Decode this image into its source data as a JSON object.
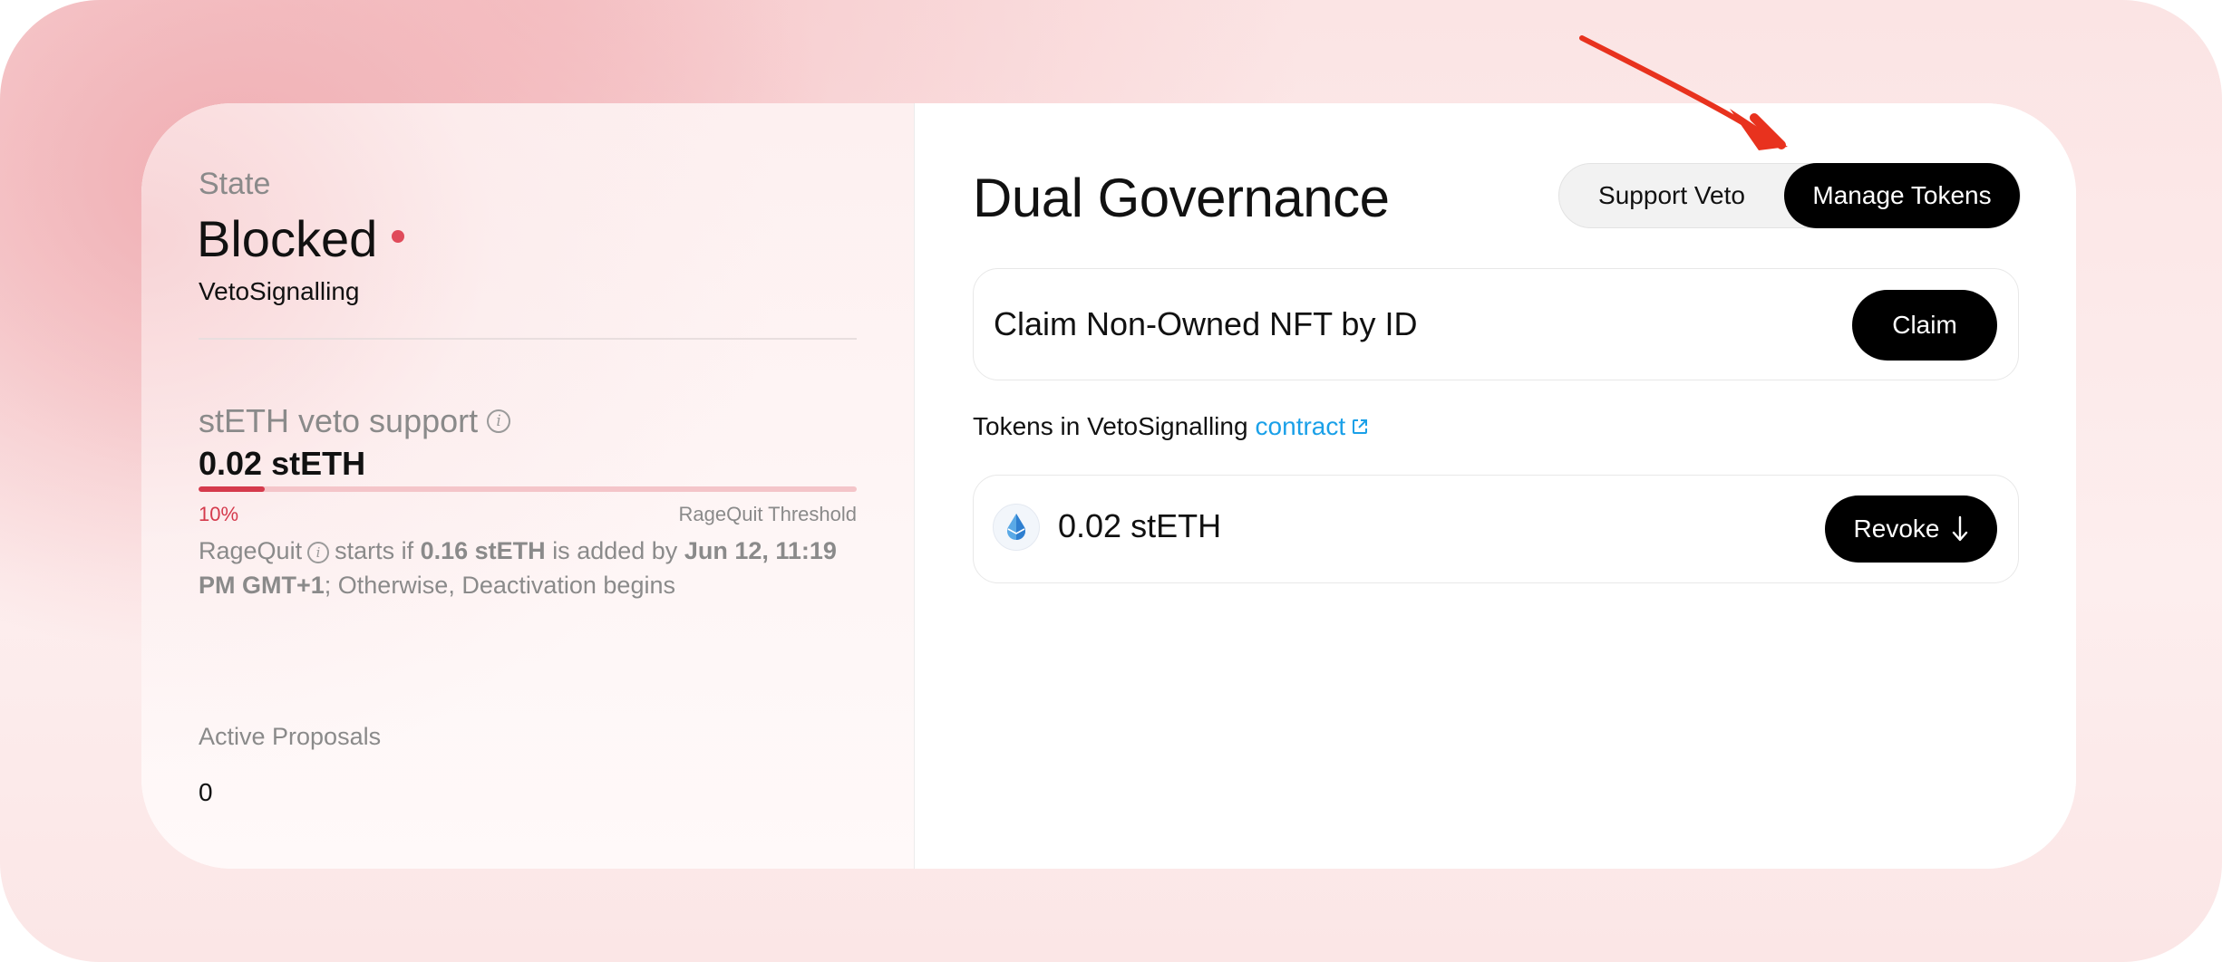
{
  "state": {
    "label": "State",
    "value": "Blocked",
    "sub": "VetoSignalling",
    "dot_color": "#e04b5b"
  },
  "veto": {
    "label": "stETH veto support",
    "value": "0.02 stETH",
    "progress_percent": 10,
    "percent_label": "10%",
    "threshold_label": "RageQuit Threshold",
    "ragequit": {
      "word": "RageQuit",
      "starts_if": "starts if",
      "amount": "0.16 stETH",
      "added_by": "is added by",
      "deadline": "Jun 12, 11:19 PM GMT+1",
      "otherwise": "; Otherwise, Deactivation begins"
    }
  },
  "proposals": {
    "label": "Active Proposals",
    "value": "0"
  },
  "main": {
    "title": "Dual Governance",
    "tabs": [
      {
        "label": "Support Veto",
        "active": false
      },
      {
        "label": "Manage Tokens",
        "active": true
      }
    ],
    "claim": {
      "label": "Claim Non-Owned NFT by ID",
      "button": "Claim"
    },
    "tokens_line": {
      "text": "Tokens in VetoSignalling",
      "link": "contract"
    },
    "token": {
      "amount": "0.02 stETH",
      "icon": "steth-drop-icon",
      "button": "Revoke"
    }
  },
  "colors": {
    "accent_red": "#d53a4c",
    "link_blue": "#1aa0e8",
    "annotation_arrow": "#e8321e"
  }
}
